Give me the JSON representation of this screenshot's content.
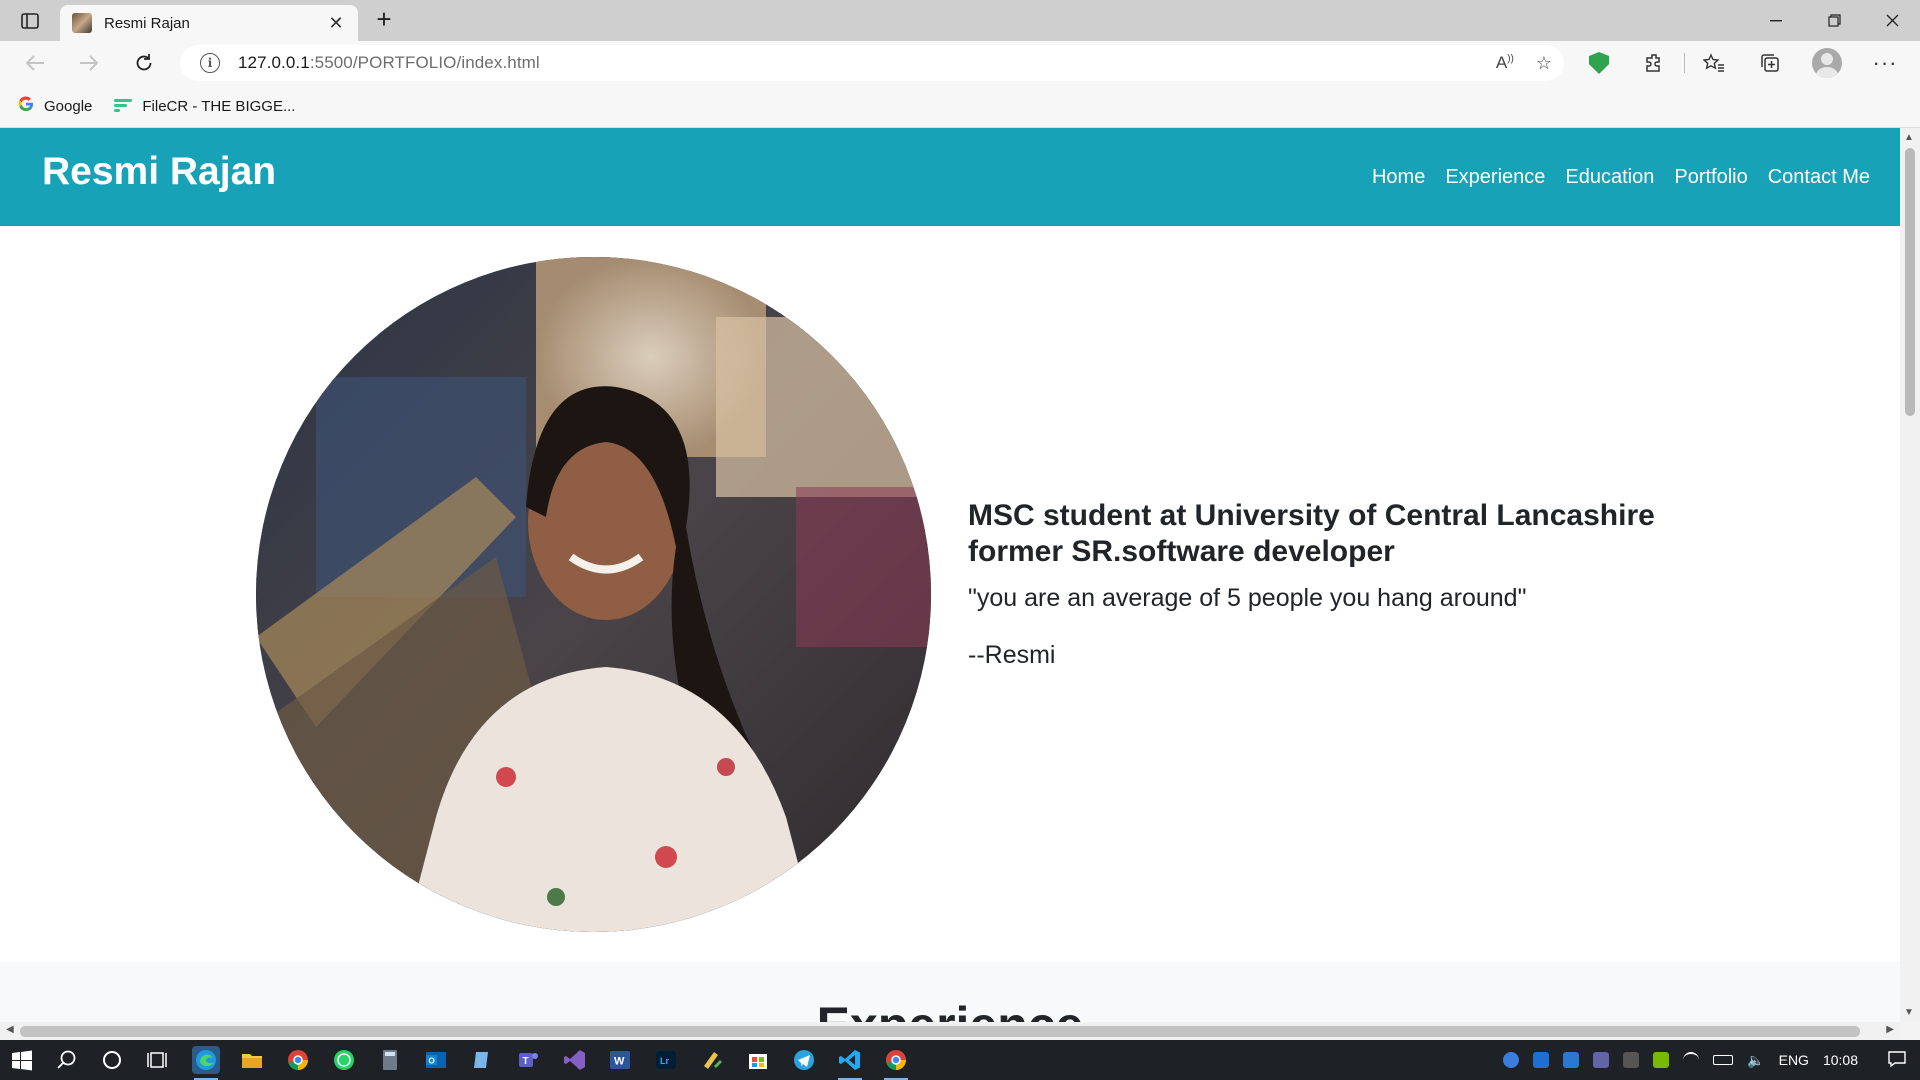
{
  "browser": {
    "tab_title": "Resmi Rajan",
    "url_host": "127.0.0.1",
    "url_rest": ":5500/PORTFOLIO/index.html",
    "bookmarks": [
      {
        "label": "Google",
        "icon": "google-icon"
      },
      {
        "label": "FileCR - THE BIGGE...",
        "icon": "filecr-icon"
      }
    ]
  },
  "site": {
    "brand": "Resmi Rajan",
    "nav": [
      "Home",
      "Experience",
      "Education",
      "Portfolio",
      "Contact Me"
    ],
    "colors": {
      "navbar": "#17a2b8",
      "text": "#212529"
    }
  },
  "hero": {
    "heading_line1": "MSC student at University of Central Lancashire",
    "heading_line2": "former SR.software developer",
    "quote": "\"you are an average of 5 people you hang around\"",
    "author": "--Resmi",
    "photo": "profile-photo"
  },
  "experience": {
    "title": "Experience"
  },
  "taskbar": {
    "tray_lang": "ENG",
    "clock": "10:08"
  }
}
